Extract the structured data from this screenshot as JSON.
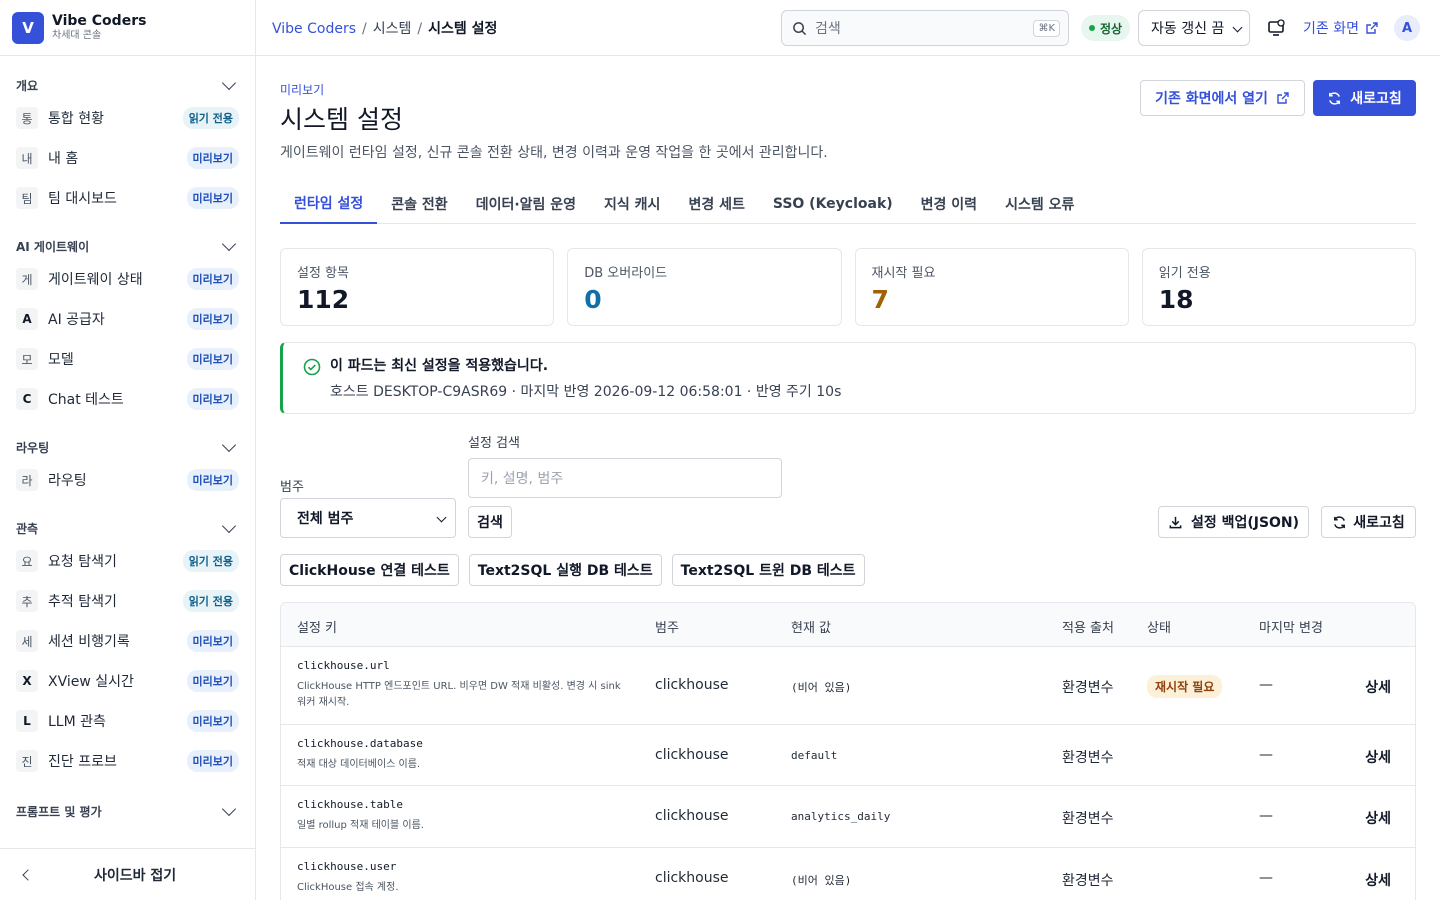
{
  "brand": {
    "initial": "V",
    "name": "Vibe Coders",
    "subtitle": "차세대 콘솔"
  },
  "sidebar": {
    "sections": [
      {
        "title": "개요",
        "items": [
          {
            "glyph": "통",
            "label": "통합 현황",
            "badge": "읽기 전용",
            "badge_type": "ro"
          },
          {
            "glyph": "내",
            "label": "내 홈",
            "badge": "미리보기",
            "badge_type": "pv"
          },
          {
            "glyph": "팀",
            "label": "팀 대시보드",
            "badge": "미리보기",
            "badge_type": "pv"
          }
        ]
      },
      {
        "title": "AI 게이트웨이",
        "items": [
          {
            "glyph": "게",
            "label": "게이트웨이 상태",
            "badge": "미리보기",
            "badge_type": "pv"
          },
          {
            "glyph": "A",
            "label": "AI 공급자",
            "badge": "미리보기",
            "badge_type": "pv",
            "strong": true
          },
          {
            "glyph": "모",
            "label": "모델",
            "badge": "미리보기",
            "badge_type": "pv"
          },
          {
            "glyph": "C",
            "label": "Chat 테스트",
            "badge": "미리보기",
            "badge_type": "pv",
            "strong": true
          }
        ]
      },
      {
        "title": "라우팅",
        "items": [
          {
            "glyph": "라",
            "label": "라우팅",
            "badge": "미리보기",
            "badge_type": "pv"
          }
        ]
      },
      {
        "title": "관측",
        "items": [
          {
            "glyph": "요",
            "label": "요청 탐색기",
            "badge": "읽기 전용",
            "badge_type": "ro"
          },
          {
            "glyph": "추",
            "label": "추적 탐색기",
            "badge": "읽기 전용",
            "badge_type": "ro"
          },
          {
            "glyph": "세",
            "label": "세션 비행기록",
            "badge": "미리보기",
            "badge_type": "pv"
          },
          {
            "glyph": "X",
            "label": "XView 실시간",
            "badge": "미리보기",
            "badge_type": "pv",
            "strong": true
          },
          {
            "glyph": "L",
            "label": "LLM 관측",
            "badge": "미리보기",
            "badge_type": "pv",
            "strong": true
          },
          {
            "glyph": "진",
            "label": "진단 프로브",
            "badge": "미리보기",
            "badge_type": "pv"
          }
        ]
      },
      {
        "title": "프롬프트 및 평가",
        "items": []
      }
    ],
    "collapse_label": "사이드바 접기"
  },
  "topbar": {
    "crumbs": [
      "Vibe Coders",
      "시스템",
      "시스템 설정"
    ],
    "search_placeholder": "검색",
    "shortcut": "⌘K",
    "status": "정상",
    "auto_refresh": "자동 갱신 끔",
    "legacy_link": "기존 화면",
    "avatar": "A"
  },
  "page": {
    "eyebrow": "미리보기",
    "title": "시스템 설정",
    "description": "게이트웨이 런타임 설정, 신규 콘솔 전환 상태, 변경 이력과 운영 작업을 한 곳에서 관리합니다.",
    "open_legacy": "기존 화면에서 열기",
    "refresh": "새로고침"
  },
  "tabs": [
    "런타임 설정",
    "콘솔 전환",
    "데이터·알림 운영",
    "지식 캐시",
    "변경 세트",
    "SSO (Keycloak)",
    "변경 이력",
    "시스템 오류"
  ],
  "cards": [
    {
      "label": "설정 항목",
      "value": "112",
      "color": "#111827"
    },
    {
      "label": "DB 오버라이드",
      "value": "0",
      "color": "#0f6fa8"
    },
    {
      "label": "재시작 필요",
      "value": "7",
      "color": "#a16207"
    },
    {
      "label": "읽기 전용",
      "value": "18",
      "color": "#111827"
    }
  ],
  "notice": {
    "title": "이 파드는 최신 설정을 적용했습니다.",
    "body": "호스트 DESKTOP-C9ASR69 · 마지막 반영 2026-09-12 06:58:01 · 반영 주기 10s"
  },
  "filters": {
    "category_label": "범주",
    "category_value": "전체 범주",
    "search_label": "설정 검색",
    "search_placeholder": "키, 설명, 범주",
    "search_button": "검색",
    "backup_button": "설정 백업(JSON)",
    "refresh_button": "새로고침"
  },
  "tests": [
    "ClickHouse 연결 테스트",
    "Text2SQL 실행 DB 테스트",
    "Text2SQL 트윈 DB 테스트"
  ],
  "table": {
    "headers": [
      "설정 키",
      "범주",
      "현재 값",
      "적용 출처",
      "상태",
      "마지막 변경"
    ],
    "rows": [
      {
        "key": "clickhouse.url",
        "desc": "ClickHouse HTTP 엔드포인트 URL. 비우면 DW 적재 비활성. 변경 시 sink 워커 재시작.",
        "category": "clickhouse",
        "value": "(비어 있음)",
        "source": "환경변수",
        "status": "재시작 필요",
        "last": "—",
        "action": "상세"
      },
      {
        "key": "clickhouse.database",
        "desc": "적재 대상 데이터베이스 이름.",
        "category": "clickhouse",
        "value": "default",
        "source": "환경변수",
        "status": "",
        "last": "—",
        "action": "상세"
      },
      {
        "key": "clickhouse.table",
        "desc": "일별 rollup 적재 테이블 이름.",
        "category": "clickhouse",
        "value": "analytics_daily",
        "source": "환경변수",
        "status": "",
        "last": "—",
        "action": "상세"
      },
      {
        "key": "clickhouse.user",
        "desc": "ClickHouse 접속 계정.",
        "category": "clickhouse",
        "value": "(비어 있음)",
        "source": "환경변수",
        "status": "",
        "last": "—",
        "action": "상세"
      }
    ]
  },
  "colors": {
    "accent": "#3550d9",
    "ok": "#16a34a",
    "warn_bg": "#fdf0d8"
  }
}
